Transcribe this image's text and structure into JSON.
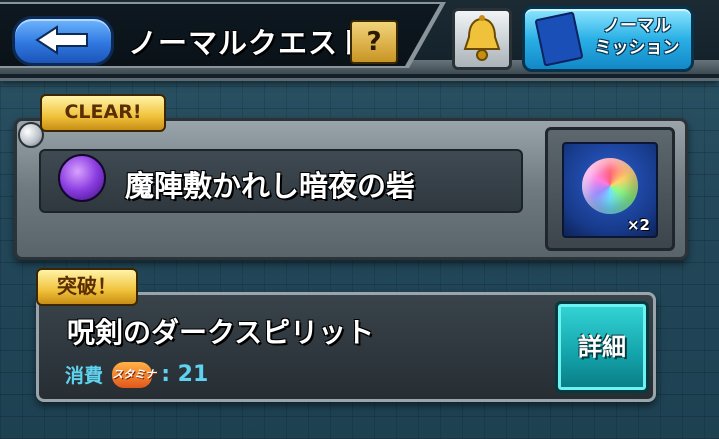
{
  "header": {
    "back_label": "",
    "title": "ノーマルクエスト",
    "help_label": "?",
    "mission_label_line1": "ノーマル",
    "mission_label_line2": "ミッション"
  },
  "stage_card": {
    "badge": "CLEAR!",
    "stage_name": "魔陣敷かれし暗夜の砦",
    "reward_count": "×2"
  },
  "quest_card": {
    "badge": "突破！",
    "quest_name": "呪剣のダークスピリット",
    "cost_label": "消費",
    "stamina_icon_text": "スタミナ",
    "cost_value": ": 21",
    "detail_label": "詳細"
  },
  "icons": {
    "back": "left-arrow-icon",
    "help": "question-icon",
    "bell": "bell-icon",
    "mission": "book-icon",
    "element": "dark-element-icon",
    "reward": "rainbow-orb-icon",
    "stamina": "stamina-icon"
  },
  "colors": {
    "accent_blue": "#2f78e0",
    "gold_badge": "#f0c23b",
    "teal_button": "#13a2aa",
    "cost_text": "#5fd2f0"
  }
}
